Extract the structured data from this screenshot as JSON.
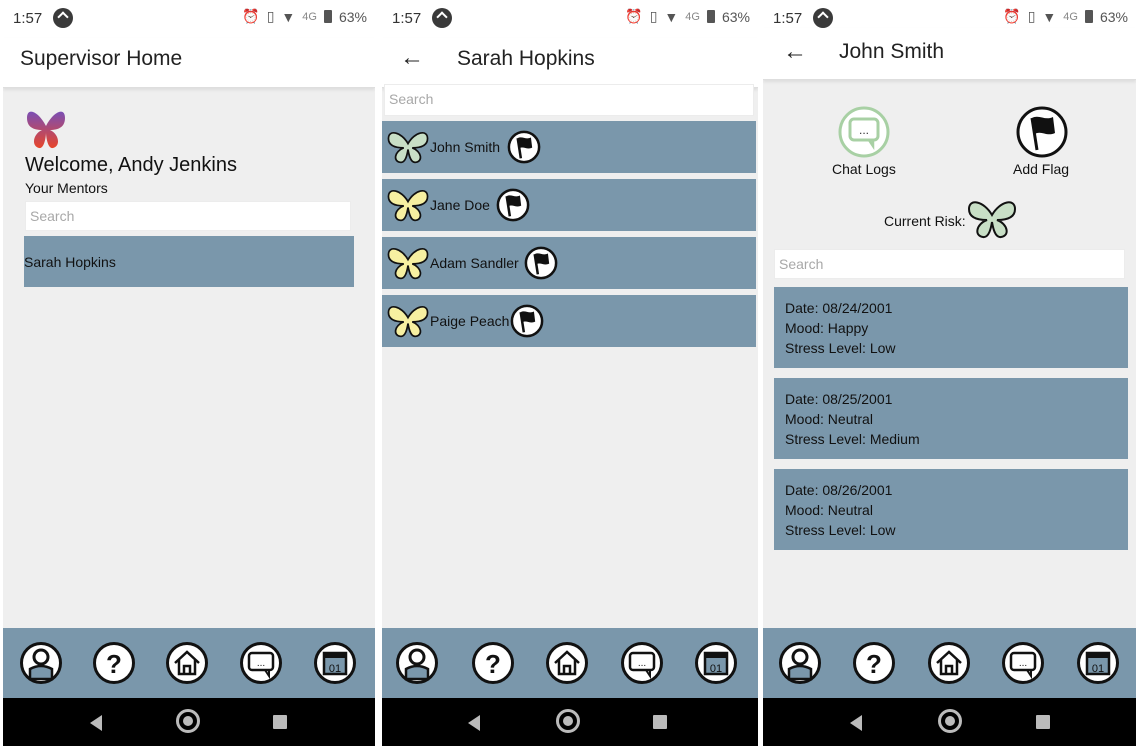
{
  "status": {
    "time": "1:57",
    "network": "4G",
    "battery": "63%"
  },
  "screen1": {
    "title": "Supervisor Home",
    "welcome": "Welcome, Andy Jenkins",
    "mentors_label": "Your Mentors",
    "search_placeholder": "Search",
    "mentors": [
      {
        "name": "Sarah Hopkins"
      }
    ]
  },
  "screen2": {
    "title": "Sarah Hopkins",
    "search_placeholder": "Search",
    "mentees": [
      {
        "name": "John Smith",
        "risk_color": "#c8dfc6"
      },
      {
        "name": "Jane Doe",
        "risk_color": "#f7f0a1"
      },
      {
        "name": "Adam Sandler",
        "risk_color": "#f7f0a1"
      },
      {
        "name": "Paige Peach",
        "risk_color": "#f7f0a1"
      }
    ]
  },
  "screen3": {
    "title": "John Smith",
    "chat_logs_label": "Chat Logs",
    "add_flag_label": "Add Flag",
    "current_risk_label": "Current Risk:",
    "search_placeholder": "Search",
    "entries": [
      {
        "date": "Date: 08/24/2001",
        "mood": "Mood: Happy",
        "stress": "Stress Level: Low"
      },
      {
        "date": "Date: 08/25/2001",
        "mood": "Mood: Neutral",
        "stress": "Stress Level: Medium"
      },
      {
        "date": "Date: 08/26/2001",
        "mood": "Mood: Neutral",
        "stress": "Stress Level: Low"
      }
    ]
  },
  "nav": {
    "icons": [
      "profile-icon",
      "help-icon",
      "home-icon",
      "chat-icon",
      "calendar-icon"
    ],
    "calendar_day": "01"
  },
  "colors": {
    "row": "#7a97ab",
    "risk_low": "#c8dfc6",
    "risk_medium": "#f7f0a1",
    "logo_top": "#7a4fb5",
    "logo_bottom": "#e8452a"
  }
}
